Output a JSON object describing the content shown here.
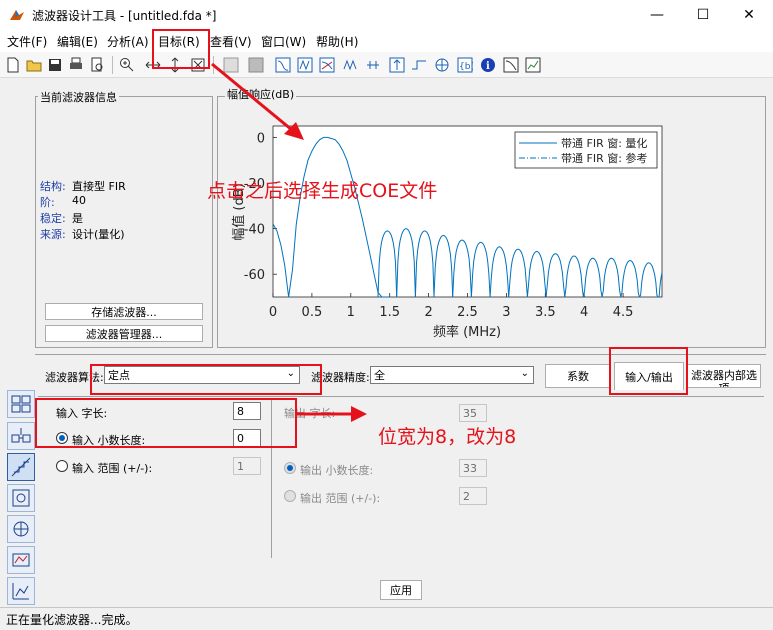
{
  "window": {
    "title": "滤波器设计工具 - [untitled.fda *]",
    "controls": {
      "minimize": "—",
      "maximize": "☐",
      "close": "✕"
    }
  },
  "menu": [
    "文件(F)",
    "编辑(E)",
    "分析(A)",
    "目标(R)",
    "查看(V)",
    "窗口(W)",
    "帮助(H)"
  ],
  "info_panel": {
    "title": "当前滤波器信息",
    "rows": [
      {
        "label": "结构:",
        "value": "直接型 FIR"
      },
      {
        "label": "阶:",
        "value": "40"
      },
      {
        "label": "稳定:",
        "value": "是"
      },
      {
        "label": "来源:",
        "value": "设计(量化)"
      }
    ],
    "store_button": "存储滤波器...",
    "manager_button": "滤波器管理器..."
  },
  "plot_panel": {
    "title": "幅值响应(dB)"
  },
  "chart_data": {
    "type": "line",
    "title": "",
    "xlabel": "频率 (MHz)",
    "ylabel": "幅值 (dB)",
    "xlim": [
      0,
      5.0
    ],
    "ylim": [
      -70,
      5
    ],
    "xticks": [
      "0",
      "0.5",
      "1",
      "1.5",
      "2",
      "2.5",
      "3",
      "3.5",
      "4",
      "4.5"
    ],
    "yticks": [
      "0",
      "-20",
      "-40",
      "-60"
    ],
    "legend": {
      "placement": "top-right",
      "entries": [
        "带通 FIR 窗: 量化",
        "带通 FIR 窗: 参考"
      ]
    },
    "series": [
      {
        "name": "带通 FIR 窗: 量化",
        "color": "#0072bd",
        "x": [
          0.0,
          0.05,
          0.1,
          0.15,
          0.2,
          0.25,
          0.3,
          0.35,
          0.4,
          0.45,
          0.5,
          0.55,
          0.6,
          0.65,
          0.7,
          0.75,
          0.8,
          0.85,
          0.9,
          0.95,
          1.0,
          1.05,
          1.1,
          1.15,
          1.2,
          1.25,
          1.3,
          1.35,
          1.4,
          1.45,
          1.5
        ],
        "y": [
          -38,
          -41,
          -47,
          -56,
          -70,
          -58,
          -38,
          -26,
          -17,
          -10,
          -6,
          -3,
          -1,
          0,
          0,
          -0.5,
          -1,
          -3,
          -6,
          -10,
          -16,
          -22,
          -29,
          -36,
          -44,
          -52,
          -60,
          -68,
          -70,
          -70,
          -70
        ]
      }
    ],
    "sidelobes": {
      "start": 1.35,
      "spacing": 0.24,
      "count": 16,
      "peaks": [
        -41,
        -40,
        -41,
        -43,
        -45,
        -46,
        -48,
        -49,
        -50,
        -51,
        -52,
        -53,
        -53,
        -54,
        -55,
        -55
      ],
      "floor": -70
    }
  },
  "settings": {
    "arith_label": "滤波器算法:",
    "arith_value": "定点",
    "precision_label": "滤波器精度:",
    "precision_value": "全",
    "tabs": [
      "系数",
      "输入/输出",
      "滤波器内部选项"
    ],
    "input_word_label": "输入 字长:",
    "input_word_value": "8",
    "input_frac_label": "输入 小数长度:",
    "input_frac_value": "0",
    "input_range_label": "输入 范围 (+/-):",
    "input_range_value": "1",
    "output_word_label": "输出 字长:",
    "output_word_value": "35",
    "output_frac_label": "输出 小数长度:",
    "output_frac_value": "33",
    "output_range_label": "输出 范围 (+/-):",
    "output_range_value": "2",
    "apply_button": "应用"
  },
  "annotations": {
    "menu_note": "点击之后选择生成COE文件",
    "word_note": "位宽为8，改为8",
    "color": "#e5121b"
  },
  "status": {
    "text": "正在量化滤波器...完成。"
  }
}
